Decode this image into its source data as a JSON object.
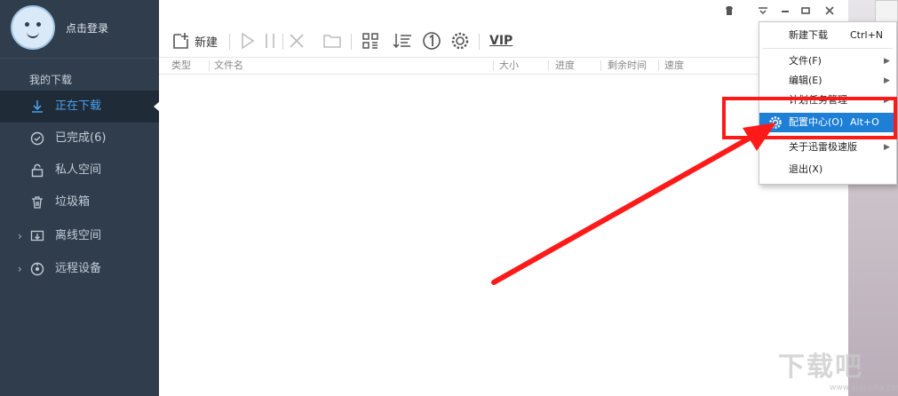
{
  "sidebar": {
    "login_text": "点击登录",
    "section_title": "我的下载",
    "items": [
      {
        "label": "正在下载",
        "icon": "download-icon",
        "active": true
      },
      {
        "label": "已完成(6)",
        "icon": "check-circle-icon"
      },
      {
        "label": "私人空间",
        "icon": "lock-icon"
      },
      {
        "label": "垃圾箱",
        "icon": "trash-icon"
      },
      {
        "label": "离线空间",
        "icon": "offline-space-icon",
        "expandable": true
      },
      {
        "label": "远程设备",
        "icon": "remote-device-icon",
        "expandable": true
      }
    ]
  },
  "toolbar": {
    "new_label": "新建",
    "vip_label": "VIP"
  },
  "columns": [
    "类型",
    "文件名",
    "大小",
    "进度",
    "剩余时间",
    "速度"
  ],
  "menu": {
    "items": [
      {
        "label": "新建下载",
        "shortcut": "Ctrl+N"
      },
      {
        "label": "文件(F)",
        "submenu": true
      },
      {
        "label": "编辑(E)",
        "submenu": true
      },
      {
        "label": "计划任务管理",
        "submenu": true
      },
      {
        "label": "配置中心(O)",
        "shortcut": "Alt+O",
        "highlighted": true
      },
      {
        "label": "关于迅雷极速版",
        "submenu": true
      },
      {
        "label": "退出(X)"
      }
    ]
  },
  "watermark": {
    "text": "下载吧",
    "url": "www.xiazaiba.com"
  },
  "colors": {
    "sidebar_bg": "#2f3d4c",
    "accent": "#4aa0ec",
    "highlight": "#1e7fd6",
    "annotation": "#ff1a1a"
  }
}
